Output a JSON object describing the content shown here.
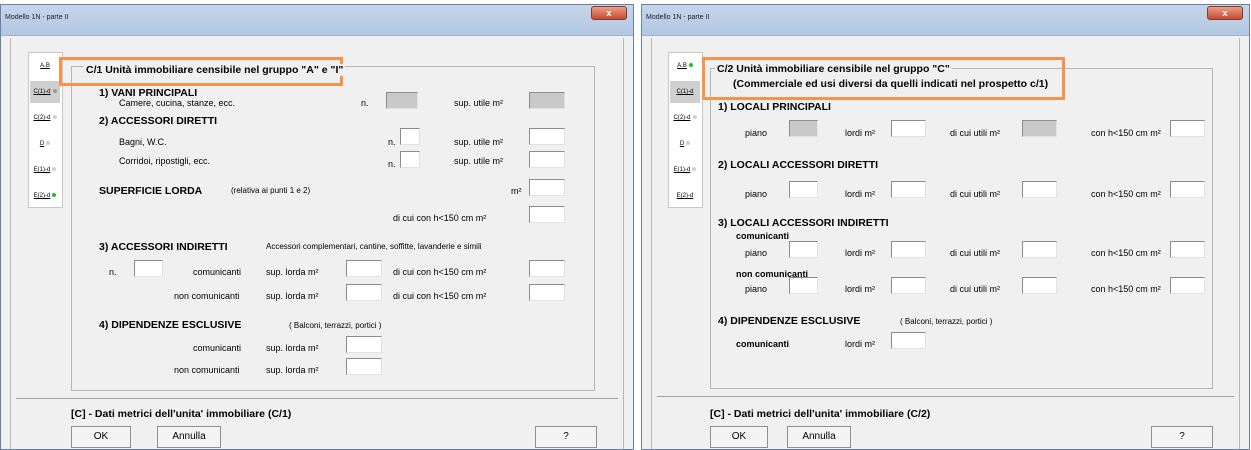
{
  "windows": [
    {
      "title": "Modello 1N  -  parte II",
      "close": "x",
      "tabs": [
        {
          "label": "A.B",
          "dot": "none"
        },
        {
          "label": "C(1)-d",
          "dot": "gray"
        },
        {
          "label": "C(2)-d",
          "dot": "light"
        },
        {
          "label": "D",
          "dot": "light"
        },
        {
          "label": "E(1)-d",
          "dot": "light"
        },
        {
          "label": "E(2)-d",
          "dot": "green"
        }
      ],
      "group_title": "C/1  Unità immobiliare censibile nel gruppo \"A\" e \"I\"",
      "s1": "1) VANI PRINCIPALI",
      "s1_desc": "Camere, cucina, stanze, ecc.",
      "n_label": "n.",
      "sup_utile": "sup. utile m²",
      "s2": "2) ACCESSORI DIRETTI",
      "s2_bagni": "Bagni, W.C.",
      "s2_corr": "Corridoi, ripostigli, ecc.",
      "s_lorda": "SUPERFICIE LORDA",
      "s_lorda_note": "(relativa ai punti 1 e 2)",
      "m2": "m²",
      "di_cui_h": "di cui con h<150 cm  m²",
      "s3": "3) ACCESSORI INDIRETTI",
      "s3_note": "Accessori complementari, cantine, soffitte, lavanderie e simili",
      "comunicanti": "comunicanti",
      "non_comunicanti": "non comunicanti",
      "sup_lorda": "sup. lorda m²",
      "s4": "4) DIPENDENZE ESCLUSIVE",
      "s4_note": "( Balconi, terrazzi, portici )",
      "footer": "[C] - Dati metrici dell'unita' immobiliare (C/1)",
      "ok": "OK",
      "cancel": "Annulla",
      "help": "?"
    },
    {
      "title": "Modello 1N  -  parte II",
      "close": "x",
      "tabs": [
        {
          "label": "A.B",
          "dot": "green"
        },
        {
          "label": "C(1)-d",
          "dot": "none"
        },
        {
          "label": "C(2)-d",
          "dot": "light"
        },
        {
          "label": "D",
          "dot": "light"
        },
        {
          "label": "E(1)-d",
          "dot": "light"
        },
        {
          "label": "E(2)-d",
          "dot": "none"
        }
      ],
      "group_title": "C/2  Unità immobiliare censibile nel gruppo \"C\"",
      "group_sub": "(Commerciale ed usi diversi da quelli indicati nel prospetto c/1)",
      "s1": "1) LOCALI PRINCIPALI",
      "piano": "piano",
      "lordi": "lordi m²",
      "utili": "di cui utili m²",
      "h150": "con h<150 cm  m²",
      "s2": "2) LOCALI ACCESSORI DIRETTI",
      "s3": "3) LOCALI ACCESSORI INDIRETTI",
      "comunicanti": "comunicanti",
      "non_comunicanti": "non comunicanti",
      "s4": "4) DIPENDENZE ESCLUSIVE",
      "s4_note": "( Balconi, terrazzi, portici )",
      "footer": "[C] - Dati metrici dell'unita' immobiliare (C/2)",
      "ok": "OK",
      "cancel": "Annulla",
      "help": "?"
    }
  ]
}
